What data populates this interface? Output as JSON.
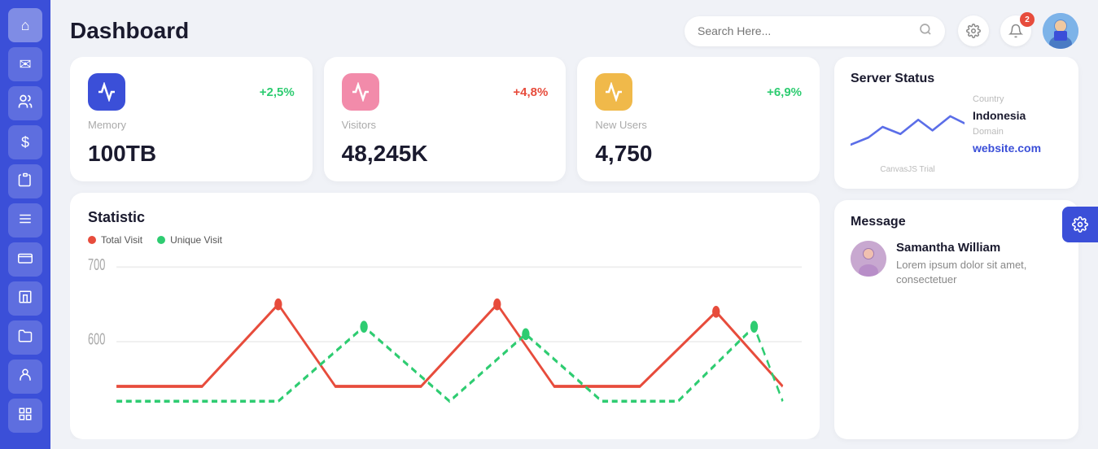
{
  "sidebar": {
    "items": [
      {
        "label": "home",
        "icon": "⌂",
        "active": true
      },
      {
        "label": "mail",
        "icon": "✉",
        "active": false
      },
      {
        "label": "users",
        "icon": "👥",
        "active": false
      },
      {
        "label": "dollar",
        "icon": "$",
        "active": false
      },
      {
        "label": "clipboard",
        "icon": "📋",
        "active": false
      },
      {
        "label": "list",
        "icon": "☰",
        "active": false
      },
      {
        "label": "wallet",
        "icon": "💳",
        "active": false
      },
      {
        "label": "building",
        "icon": "🏢",
        "active": false
      },
      {
        "label": "folder",
        "icon": "📁",
        "active": false
      },
      {
        "label": "person",
        "icon": "👤",
        "active": false
      },
      {
        "label": "grid",
        "icon": "⊞",
        "active": false
      }
    ]
  },
  "header": {
    "title": "Dashboard",
    "search_placeholder": "Search Here...",
    "notification_count": "2"
  },
  "stats": [
    {
      "icon": "〜",
      "icon_color": "blue",
      "percent": "+2,5%",
      "percent_type": "green",
      "label": "Memory",
      "value": "100TB"
    },
    {
      "icon": "〜",
      "icon_color": "pink",
      "percent": "+4,8%",
      "percent_type": "red",
      "label": "Visitors",
      "value": "48,245K"
    },
    {
      "icon": "〜",
      "icon_color": "yellow",
      "percent": "+6,9%",
      "percent_type": "green",
      "label": "New Users",
      "value": "4,750"
    }
  ],
  "statistic": {
    "title": "Statistic",
    "legend": [
      {
        "label": "Total Visit",
        "color": "red"
      },
      {
        "label": "Unique Visit",
        "color": "green"
      }
    ],
    "y_labels": [
      "700",
      "600"
    ]
  },
  "server_status": {
    "title": "Server Status",
    "country_label": "Country",
    "country_value": "Indonesia",
    "domain_label": "Domain",
    "domain_value": "website.com",
    "canvasjs_label": "CanvasJS Trial"
  },
  "message": {
    "title": "Message",
    "items": [
      {
        "name": "Samantha William",
        "text": "Lorem ipsum dolor sit amet, consectetuer"
      }
    ]
  },
  "floating_btn": {
    "icon": "⚙"
  }
}
